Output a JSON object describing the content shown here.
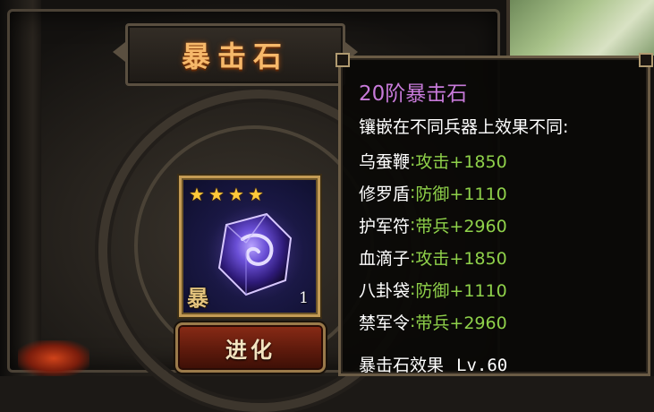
{
  "panel": {
    "title": "暴击石"
  },
  "item": {
    "stars": 4,
    "badge": "暴",
    "count": "1",
    "icon": "purple-gem-icon"
  },
  "evolve_button": {
    "label": "进化"
  },
  "tooltip": {
    "title": "20阶暴击石",
    "description": "镶嵌在不同兵器上效果不同:",
    "stats": [
      {
        "weapon": "乌蚕鞭",
        "sep": ":",
        "effect": "攻击+1850"
      },
      {
        "weapon": "修罗盾",
        "sep": ":",
        "effect": "防御+1110"
      },
      {
        "weapon": "护军符",
        "sep": ":",
        "effect": "带兵+2960"
      },
      {
        "weapon": "血滴子",
        "sep": ":",
        "effect": "攻击+1850"
      },
      {
        "weapon": "八卦袋",
        "sep": ":",
        "effect": "防御+1110"
      },
      {
        "weapon": "禁军令",
        "sep": ":",
        "effect": "带兵+2960"
      }
    ],
    "footer_label": "暴击石效果",
    "footer_level": "Lv.60"
  },
  "colors": {
    "title_gold": "#f6b86a",
    "tooltip_title_purple": "#c77ad9",
    "stat_green": "#8fd14a",
    "card_border": "#c39b55"
  }
}
